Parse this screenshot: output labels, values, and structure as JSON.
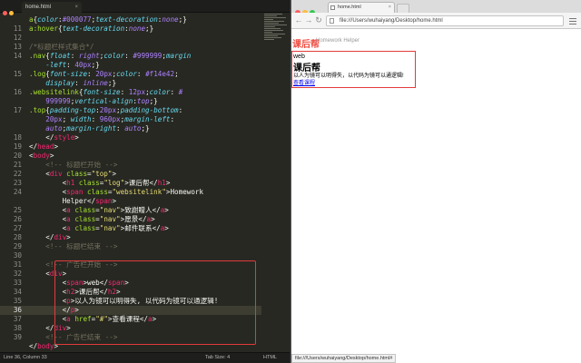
{
  "editor": {
    "tab_title": "home.html",
    "tab_close": "×",
    "line_numbers": [
      "",
      "11",
      "12",
      "13",
      "14",
      "",
      "15",
      "",
      "16",
      "",
      "17",
      "",
      "",
      "18",
      "19",
      "20",
      "21",
      "22",
      "23",
      "24",
      "",
      "25",
      "26",
      "27",
      "28",
      "29",
      "30",
      "31",
      "32",
      "33",
      "34",
      "35",
      "36",
      "37",
      "38",
      "39"
    ],
    "lines": [
      [
        [
          "t-sel",
          "a"
        ],
        [
          "t-pun",
          "{"
        ],
        [
          "t-prop",
          "color"
        ],
        [
          "t-pun",
          ":"
        ],
        [
          "t-val",
          "#000077"
        ],
        [
          "t-pun",
          ";"
        ],
        [
          "t-prop",
          "text-decoration"
        ],
        [
          "t-pun",
          ":"
        ],
        [
          "t-vi",
          "none"
        ],
        [
          "t-pun",
          ";}"
        ]
      ],
      [
        [
          "t-sel",
          "a:hover"
        ],
        [
          "t-pun",
          "{"
        ],
        [
          "t-prop",
          "text-decoration"
        ],
        [
          "t-pun",
          ":"
        ],
        [
          "t-vi",
          "none"
        ],
        [
          "t-pun",
          ";}"
        ]
      ],
      [],
      [
        [
          "t-cmt",
          "/*标题栏样式集合*/"
        ]
      ],
      [
        [
          "t-sel",
          ".nav"
        ],
        [
          "t-pun",
          "{"
        ],
        [
          "t-prop",
          "float"
        ],
        [
          "t-pun",
          ": "
        ],
        [
          "t-vi",
          "right"
        ],
        [
          "t-pun",
          ";"
        ],
        [
          "t-prop",
          "color"
        ],
        [
          "t-pun",
          ": "
        ],
        [
          "t-val",
          "#999999"
        ],
        [
          "t-pun",
          ";"
        ],
        [
          "t-prop",
          "margin"
        ]
      ],
      [
        [
          "t-prop",
          "    -left"
        ],
        [
          "t-pun",
          ": "
        ],
        [
          "t-val",
          "40px"
        ],
        [
          "t-pun",
          ";}"
        ]
      ],
      [
        [
          "t-sel",
          ".log"
        ],
        [
          "t-pun",
          "{"
        ],
        [
          "t-prop",
          "font-size"
        ],
        [
          "t-pun",
          ": "
        ],
        [
          "t-val",
          "20px"
        ],
        [
          "t-pun",
          ";"
        ],
        [
          "t-prop",
          "color"
        ],
        [
          "t-pun",
          ": "
        ],
        [
          "t-val",
          "#f14e42"
        ],
        [
          "t-pun",
          ";"
        ]
      ],
      [
        [
          "t-prop",
          "    display"
        ],
        [
          "t-pun",
          ": "
        ],
        [
          "t-vi",
          "inline"
        ],
        [
          "t-pun",
          ";}"
        ]
      ],
      [
        [
          "t-sel",
          ".websitelink"
        ],
        [
          "t-pun",
          "{"
        ],
        [
          "t-prop",
          "font-size"
        ],
        [
          "t-pun",
          ": "
        ],
        [
          "t-val",
          "12px"
        ],
        [
          "t-pun",
          ";"
        ],
        [
          "t-prop",
          "color"
        ],
        [
          "t-pun",
          ": "
        ],
        [
          "t-val",
          "#"
        ]
      ],
      [
        [
          "t-val",
          "    999999"
        ],
        [
          "t-pun",
          ";"
        ],
        [
          "t-prop",
          "vertical-align"
        ],
        [
          "t-pun",
          ":"
        ],
        [
          "t-vi",
          "top"
        ],
        [
          "t-pun",
          ";}"
        ]
      ],
      [
        [
          "t-sel",
          ".top"
        ],
        [
          "t-pun",
          "{"
        ],
        [
          "t-prop",
          "padding-top"
        ],
        [
          "t-pun",
          ":"
        ],
        [
          "t-val",
          "20px"
        ],
        [
          "t-pun",
          ";"
        ],
        [
          "t-prop",
          "padding-bottom"
        ],
        [
          "t-pun",
          ":"
        ]
      ],
      [
        [
          "t-val",
          "    20px"
        ],
        [
          "t-pun",
          "; "
        ],
        [
          "t-prop",
          "width"
        ],
        [
          "t-pun",
          ": "
        ],
        [
          "t-val",
          "960px"
        ],
        [
          "t-pun",
          ";"
        ],
        [
          "t-prop",
          "margin-left"
        ],
        [
          "t-pun",
          ":"
        ]
      ],
      [
        [
          "t-vi",
          "    auto"
        ],
        [
          "t-pun",
          ";"
        ],
        [
          "t-prop",
          "margin-right"
        ],
        [
          "t-pun",
          ": "
        ],
        [
          "t-vi",
          "auto"
        ],
        [
          "t-pun",
          ";}"
        ]
      ],
      [
        [
          "t-pun",
          "    </"
        ],
        [
          "t-tag",
          "style"
        ],
        [
          "t-pun",
          ">"
        ]
      ],
      [
        [
          "t-pun",
          "</"
        ],
        [
          "t-tag",
          "head"
        ],
        [
          "t-pun",
          ">"
        ]
      ],
      [
        [
          "t-pun",
          "<"
        ],
        [
          "t-tag",
          "body"
        ],
        [
          "t-pun",
          ">"
        ]
      ],
      [
        [
          "t-cmt",
          "    <!-- 标题栏开始 -->"
        ]
      ],
      [
        [
          "t-pun",
          "    <"
        ],
        [
          "t-tag",
          "div"
        ],
        [
          "t-pun",
          " "
        ],
        [
          "t-attr",
          "class"
        ],
        [
          "t-pun",
          "="
        ],
        [
          "t-str",
          "\"top\""
        ],
        [
          "t-pun",
          ">"
        ]
      ],
      [
        [
          "t-pun",
          "        <"
        ],
        [
          "t-tag",
          "h1"
        ],
        [
          "t-pun",
          " "
        ],
        [
          "t-attr",
          "class"
        ],
        [
          "t-pun",
          "="
        ],
        [
          "t-str",
          "\"log\""
        ],
        [
          "t-pun",
          ">"
        ],
        [
          "t-txt",
          "课后帮"
        ],
        [
          "t-pun",
          "</"
        ],
        [
          "t-tag",
          "h1"
        ],
        [
          "t-pun",
          ">"
        ]
      ],
      [
        [
          "t-pun",
          "        <"
        ],
        [
          "t-tag",
          "span"
        ],
        [
          "t-pun",
          " "
        ],
        [
          "t-attr",
          "class"
        ],
        [
          "t-pun",
          "="
        ],
        [
          "t-str",
          "\"websitelink\""
        ],
        [
          "t-pun",
          ">"
        ],
        [
          "t-txt",
          "Homework"
        ]
      ],
      [
        [
          "t-txt",
          "        Helper"
        ],
        [
          "t-pun",
          "</"
        ],
        [
          "t-tag",
          "span"
        ],
        [
          "t-pun",
          ">"
        ]
      ],
      [
        [
          "t-pun",
          "        <"
        ],
        [
          "t-tag",
          "a"
        ],
        [
          "t-pun",
          " "
        ],
        [
          "t-attr",
          "class"
        ],
        [
          "t-pun",
          "="
        ],
        [
          "t-str",
          "\"nav\""
        ],
        [
          "t-pun",
          ">"
        ],
        [
          "t-txt",
          "致謝贈人"
        ],
        [
          "t-pun",
          "</"
        ],
        [
          "t-tag",
          "a"
        ],
        [
          "t-pun",
          ">"
        ]
      ],
      [
        [
          "t-pun",
          "        <"
        ],
        [
          "t-tag",
          "a"
        ],
        [
          "t-pun",
          " "
        ],
        [
          "t-attr",
          "class"
        ],
        [
          "t-pun",
          "="
        ],
        [
          "t-str",
          "\"nav\""
        ],
        [
          "t-pun",
          ">"
        ],
        [
          "t-txt",
          "愿景"
        ],
        [
          "t-pun",
          "</"
        ],
        [
          "t-tag",
          "a"
        ],
        [
          "t-pun",
          ">"
        ]
      ],
      [
        [
          "t-pun",
          "        <"
        ],
        [
          "t-tag",
          "a"
        ],
        [
          "t-pun",
          " "
        ],
        [
          "t-attr",
          "class"
        ],
        [
          "t-pun",
          "="
        ],
        [
          "t-str",
          "\"nav\""
        ],
        [
          "t-pun",
          ">"
        ],
        [
          "t-txt",
          "邮件联系"
        ],
        [
          "t-pun",
          "</"
        ],
        [
          "t-tag",
          "a"
        ],
        [
          "t-pun",
          ">"
        ]
      ],
      [
        [
          "t-pun",
          "    </"
        ],
        [
          "t-tag",
          "div"
        ],
        [
          "t-pun",
          ">"
        ]
      ],
      [
        [
          "t-cmt",
          "    <!-- 标题栏结束 -->"
        ]
      ],
      [],
      [
        [
          "t-cmt",
          "    <!-- 广告栏开始 -->"
        ]
      ],
      [
        [
          "t-pun",
          "    <"
        ],
        [
          "t-tag",
          "div"
        ],
        [
          "t-pun",
          ">"
        ]
      ],
      [
        [
          "t-pun",
          "        <"
        ],
        [
          "t-tag",
          "span"
        ],
        [
          "t-pun",
          ">"
        ],
        [
          "t-txt",
          "web"
        ],
        [
          "t-pun",
          "</"
        ],
        [
          "t-tag",
          "span"
        ],
        [
          "t-pun",
          ">"
        ]
      ],
      [
        [
          "t-pun",
          "        <"
        ],
        [
          "t-tag",
          "h2"
        ],
        [
          "t-pun",
          ">"
        ],
        [
          "t-txt",
          "课后帮"
        ],
        [
          "t-pun",
          "</"
        ],
        [
          "t-tag",
          "h2"
        ],
        [
          "t-pun",
          ">"
        ]
      ],
      [
        [
          "t-pun",
          "        <"
        ],
        [
          "t-tag",
          "p"
        ],
        [
          "t-pun",
          ">"
        ],
        [
          "t-txt",
          "以人为镜可以明得失, 以代码为镜可以通逻辑!"
        ]
      ],
      [
        [
          "t-pun",
          "        </"
        ],
        [
          "t-tag",
          "p"
        ],
        [
          "t-pun",
          ">"
        ]
      ],
      [
        [
          "t-pun",
          "        <"
        ],
        [
          "t-tag",
          "a"
        ],
        [
          "t-pun",
          " "
        ],
        [
          "t-attr",
          "href"
        ],
        [
          "t-pun",
          "="
        ],
        [
          "t-str",
          "\"#\""
        ],
        [
          "t-pun",
          ">"
        ],
        [
          "t-txt",
          "查看课程"
        ],
        [
          "t-pun",
          "</"
        ],
        [
          "t-tag",
          "a"
        ],
        [
          "t-pun",
          ">"
        ]
      ],
      [
        [
          "t-pun",
          "    </"
        ],
        [
          "t-tag",
          "div"
        ],
        [
          "t-pun",
          ">"
        ]
      ],
      [
        [
          "t-cmt",
          "    <!-- 广告栏结束 -->"
        ]
      ],
      [
        [
          "t-pun",
          "</"
        ],
        [
          "t-tag",
          "body"
        ],
        [
          "t-pun",
          ">"
        ]
      ]
    ],
    "current_line_index": 32,
    "status": {
      "position": "Line 36, Column 33",
      "tab_size": "Tab Size: 4",
      "syntax": "HTML"
    }
  },
  "browser": {
    "tab_title": "home.html",
    "tab_close": "×",
    "back": "←",
    "forward": "→",
    "reload": "↻",
    "url": "file:///Users/wuhaiyang/Desktop/home.html",
    "status_url": "file:///Users/wuhaiyang/Desktop/home.html#",
    "page": {
      "logo": "课后帮",
      "helper": "Homework Helper",
      "ad_span": "web",
      "ad_heading": "课后帮",
      "ad_paragraph": "以人为镜可以明得失，以代码为镜可以通逻辑!",
      "ad_link": "查看课程"
    }
  },
  "colors": {
    "highlight": "#e23b3b",
    "logo": "#f14e42",
    "helper": "#999999"
  }
}
